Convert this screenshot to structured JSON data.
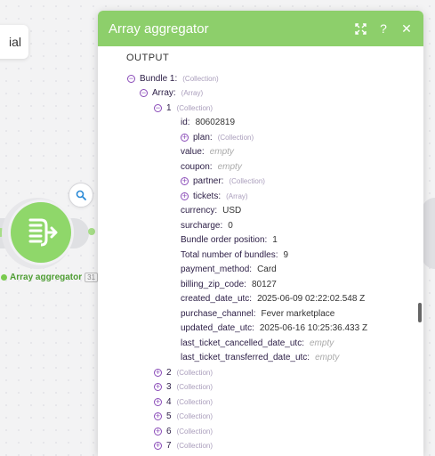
{
  "canvas": {
    "tutorial_fragment": "ial",
    "module_label": "Array aggregator",
    "module_id": "31",
    "colors": {
      "module_green": "#8fd76a",
      "label_green": "#4e9d33"
    }
  },
  "panel": {
    "title": "Array aggregator",
    "header_color": "#8dcf6b",
    "actions": [
      "expand-icon",
      "help-icon",
      "close-icon"
    ],
    "help_glyph": "?",
    "close_glyph": "✕",
    "output_label": "OUTPUT",
    "tree": [
      {
        "depth": 0,
        "toggle": "minus",
        "key": "Bundle 1:",
        "type": "(Collection)"
      },
      {
        "depth": 1,
        "toggle": "minus",
        "key": "Array:",
        "type": "(Array)"
      },
      {
        "depth": 2,
        "toggle": "minus",
        "key": "1",
        "type": "(Collection)"
      },
      {
        "depth": 3,
        "toggle": "none",
        "key": "id:",
        "value": "80602819"
      },
      {
        "depth": 3,
        "toggle": "plus",
        "key": "plan:",
        "type": "(Collection)"
      },
      {
        "depth": 3,
        "toggle": "none",
        "key": "value:",
        "empty": "empty"
      },
      {
        "depth": 3,
        "toggle": "none",
        "key": "coupon:",
        "empty": "empty"
      },
      {
        "depth": 3,
        "toggle": "plus",
        "key": "partner:",
        "type": "(Collection)"
      },
      {
        "depth": 3,
        "toggle": "plus",
        "key": "tickets:",
        "type": "(Array)"
      },
      {
        "depth": 3,
        "toggle": "none",
        "key": "currency:",
        "value": "USD"
      },
      {
        "depth": 3,
        "toggle": "none",
        "key": "surcharge:",
        "value": "0"
      },
      {
        "depth": 3,
        "toggle": "none",
        "key": "Bundle order position:",
        "value": "1"
      },
      {
        "depth": 3,
        "toggle": "none",
        "key": "Total number of bundles:",
        "value": "9"
      },
      {
        "depth": 3,
        "toggle": "none",
        "key": "payment_method:",
        "value": "Card"
      },
      {
        "depth": 3,
        "toggle": "none",
        "key": "billing_zip_code:",
        "value": "80127"
      },
      {
        "depth": 3,
        "toggle": "none",
        "key": "created_date_utc:",
        "value": "2025-06-09 02:22:02.548 Z"
      },
      {
        "depth": 3,
        "toggle": "none",
        "key": "purchase_channel:",
        "value": "Fever marketplace"
      },
      {
        "depth": 3,
        "toggle": "none",
        "key": "updated_date_utc:",
        "value": "2025-06-16 10:25:36.433 Z"
      },
      {
        "depth": 3,
        "toggle": "none",
        "key": "last_ticket_cancelled_date_utc:",
        "empty": "empty"
      },
      {
        "depth": 3,
        "toggle": "none",
        "key": "last_ticket_transferred_date_utc:",
        "empty": "empty"
      },
      {
        "depth": 2,
        "toggle": "plus",
        "key": "2",
        "type": "(Collection)"
      },
      {
        "depth": 2,
        "toggle": "plus",
        "key": "3",
        "type": "(Collection)"
      },
      {
        "depth": 2,
        "toggle": "plus",
        "key": "4",
        "type": "(Collection)"
      },
      {
        "depth": 2,
        "toggle": "plus",
        "key": "5",
        "type": "(Collection)"
      },
      {
        "depth": 2,
        "toggle": "plus",
        "key": "6",
        "type": "(Collection)"
      },
      {
        "depth": 2,
        "toggle": "plus",
        "key": "7",
        "type": "(Collection)"
      }
    ]
  }
}
